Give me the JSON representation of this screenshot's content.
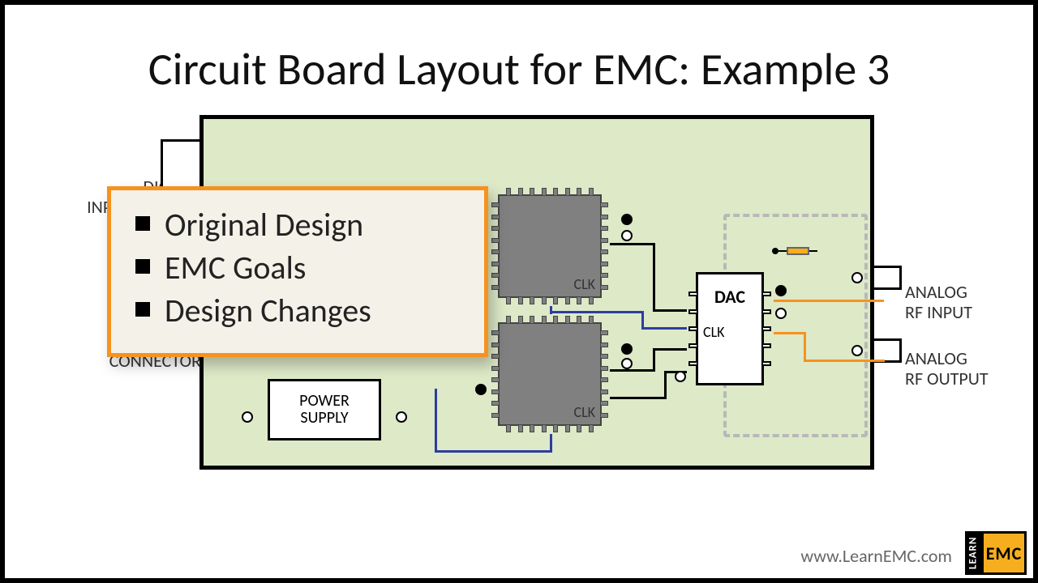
{
  "title": "Circuit Board Layout for EMC: Example 3",
  "overlay": {
    "item1": "Original Design",
    "item2": "EMC Goals",
    "item3": "Design Changes"
  },
  "labels": {
    "digital_io": "DIGITAL\nINPUT/OUTPUT\nCONNECTOR",
    "power_conn": "POWER\nCONNECTOR",
    "analog_in": "ANALOG\nRF INPUT",
    "analog_out": "ANALOG\nRF OUTPUT",
    "supply_top": "POWER",
    "supply_bot": "SUPPLY",
    "clk": "CLK",
    "dac": "DAC"
  },
  "footer": {
    "website": "www.LearnEMC.com",
    "logo_learn": "LEARN",
    "logo_emc": "EMC"
  },
  "colors": {
    "pcb": "#DDE9C7",
    "accent": "#F6921E",
    "blue": "#2C3E9E"
  }
}
